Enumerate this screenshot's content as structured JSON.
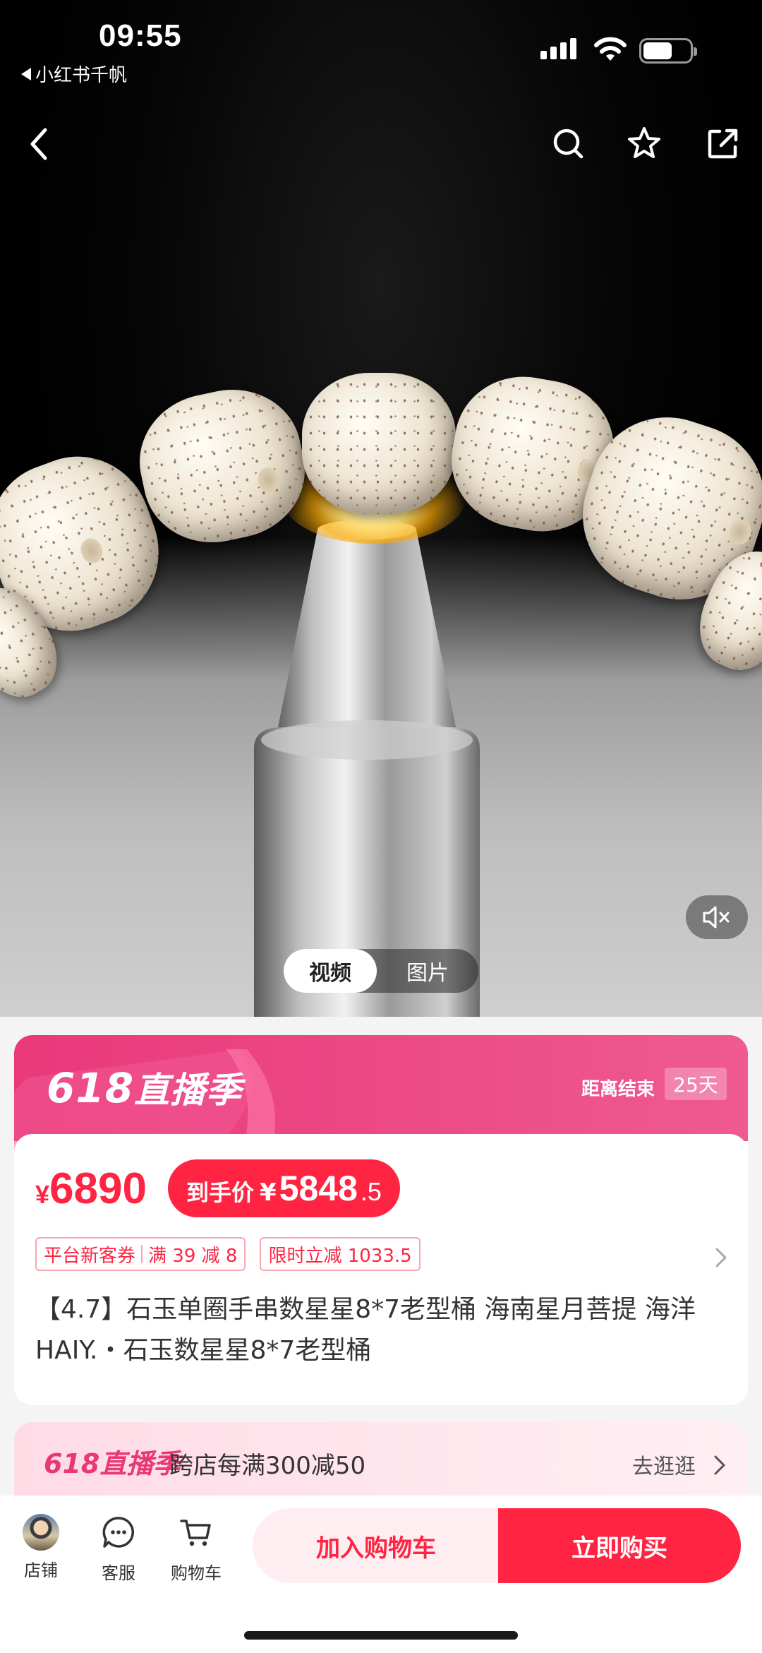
{
  "status_bar": {
    "time": "09:55",
    "back_app_label": "小红书千帆"
  },
  "top_nav": {
    "back_icon": "chevron-left-icon",
    "search_icon": "search-icon",
    "favorite_icon": "star-icon",
    "share_icon": "share-icon"
  },
  "media": {
    "tabs": [
      {
        "label": "视频",
        "active": true
      },
      {
        "label": "图片",
        "active": false
      }
    ],
    "mute_icon": "speaker-muted-icon"
  },
  "banner": {
    "logo_num": "618",
    "logo_text": "直播季",
    "countdown_label": "距离结束",
    "countdown_value": "25天",
    "color": "#e9397a"
  },
  "price": {
    "currency": "¥",
    "original": "6890",
    "deal_label": "到手价",
    "deal_currency": "¥",
    "deal_integer": "5848",
    "deal_decimal": ".5"
  },
  "coupons": [
    {
      "part1": "平台新客券",
      "part2": "满 39 减 8"
    },
    {
      "part1": "限时立减 1033.5"
    }
  ],
  "product": {
    "title": "【4.7】石玉单圈手串数星星8*7老型桶 海南星月菩提 海洋HAIY.・石玉数星星8*7老型桶"
  },
  "promo": {
    "logo_num": "618",
    "logo_text": "直播季",
    "text": "跨店每满300减50",
    "link": "去逛逛"
  },
  "bottom_bar": {
    "store": "店铺",
    "service": "客服",
    "cart": "购物车",
    "add_to_cart": "加入购物车",
    "buy_now": "立即购买",
    "accent": "#ff2442"
  }
}
